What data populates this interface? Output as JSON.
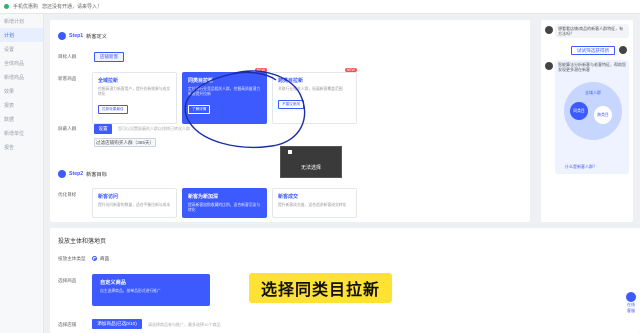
{
  "topbar": {
    "title": "手机优惠购",
    "subtitle": "您还没有开通，请来导入！"
  },
  "sidebar": {
    "items": [
      "新增计划",
      "计划",
      "设置",
      "全体商品",
      "新增商品",
      "效果",
      "报表",
      "数据",
      "新增单位",
      "报告"
    ]
  },
  "step1": {
    "label": "Step1",
    "title": "新客定义"
  },
  "step2": {
    "label": "Step2",
    "title": "新客目标"
  },
  "target": {
    "label": "目标人群",
    "button": "店铺新客"
  },
  "new_cust": {
    "label": "新客商品"
  },
  "cards": [
    {
      "title": "全域拉新",
      "desc": "挖掘高潜力新客用户，提升拉新效果与成交转化",
      "tag": "拉新效果最佳",
      "new": ""
    },
    {
      "title": "同类目拉新",
      "desc": "定位同行业竞品相关人群，挖掘高质量潜力新客提升拉新",
      "tag": "了解详情",
      "new": "NEW"
    },
    {
      "title": "跨类目拉新",
      "desc": "关联行业相关人群，拓展新客覆盖范围",
      "tag": "不建议使用",
      "new": "NEW"
    }
  ],
  "exclude": {
    "label": "屏蔽人群",
    "button": "设置",
    "hint": "您可以设置屏蔽的人群以排除已转化人群",
    "selected": "过滤店铺购买人群（365天）"
  },
  "goal": {
    "label": "优化目标"
  },
  "goal_cards": [
    {
      "title": "新客访问",
      "desc": "提升访问新客的数量，适合平衡拉新与成本"
    },
    {
      "title": "新客为新加深",
      "desc": "提高新客加购收藏的比例，适合新客沉淀与转化"
    },
    {
      "title": "新客成交",
      "desc": "提升新客成交量，适合追求新客成交转化"
    }
  ],
  "tooltip": {
    "text": "无法选择"
  },
  "right_panel": {
    "question": "想看看店铺/商品的新客人群特征，有方法吗？",
    "link": "试试筛选获得新",
    "tip": "智能算法分析新客与老客特征，帮助您发现更多潜在新客",
    "labels": [
      "全域人群",
      "同类目",
      "跨类目"
    ],
    "more": "什么是新客人群？"
  },
  "section2": {
    "title": "投放主体和落地页",
    "subject_label": "投放主体类型",
    "subject_value": "商品",
    "type_label": "选择商品",
    "promo_title": "自定义商品",
    "promo_desc": "自主选择商品，按单品形式进行推广",
    "bottom_label": "选择店铺",
    "add_button": "添加商品(已选0/10)",
    "bottom_hint": "请选择商品参与推广，最多选择10个商品"
  },
  "caption": "选择同类目拉新",
  "floating": {
    "line1": "在线",
    "line2": "客服"
  }
}
